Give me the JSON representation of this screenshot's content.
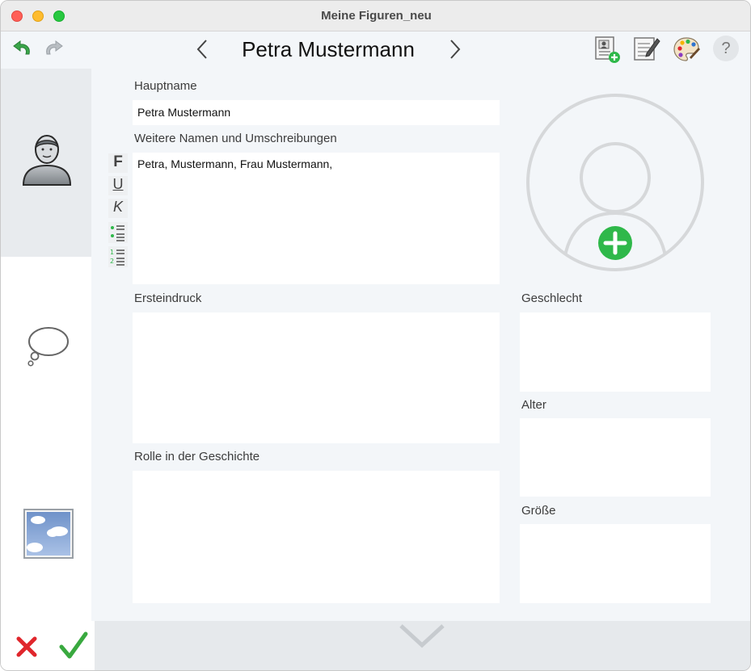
{
  "window": {
    "title": "Meine Figuren_neu"
  },
  "toolbar": {
    "character_name": "Petra Mustermann",
    "help_label": "?"
  },
  "fields": {
    "hauptname": {
      "label": "Hauptname",
      "value": "Petra Mustermann"
    },
    "weitere_namen": {
      "label": "Weitere Namen und Umschreibungen",
      "value": "Petra, Mustermann, Frau Mustermann,"
    },
    "ersteindruck": {
      "label": "Ersteindruck",
      "value": ""
    },
    "rolle": {
      "label": "Rolle in der Geschichte",
      "value": ""
    },
    "geschlecht": {
      "label": "Geschlecht",
      "value": ""
    },
    "alter": {
      "label": "Alter",
      "value": ""
    },
    "groesse": {
      "label": "Größe",
      "value": ""
    }
  },
  "format_toolbar": {
    "bold": "F",
    "underline": "U",
    "italic": "K"
  },
  "colors": {
    "accent_green": "#2fb84a",
    "cancel_red": "#e0262c"
  },
  "icons": {
    "undo": "undo-arrow",
    "redo": "redo-arrow",
    "prev": "chevron-left",
    "next": "chevron-right",
    "add_card": "add-contact-card",
    "edit_note": "edit-note",
    "palette": "paint-palette",
    "help": "question-mark",
    "person": "person-silhouette",
    "speech": "speech-bubble",
    "image": "sky-picture",
    "cancel": "red-x",
    "ok": "green-check",
    "expand": "chevron-down"
  }
}
